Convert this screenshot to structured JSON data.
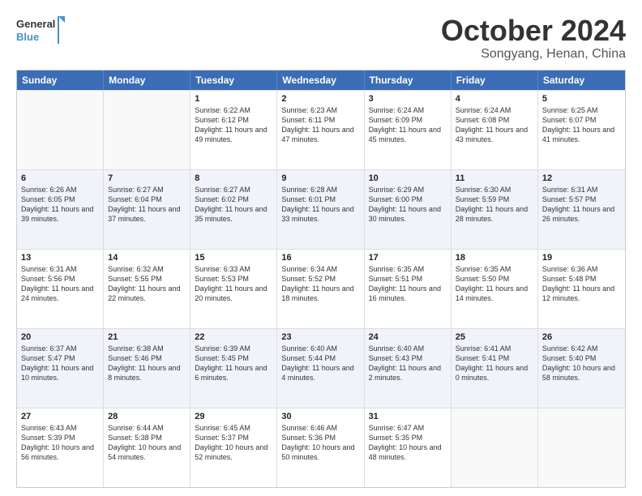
{
  "logo": {
    "line1": "General",
    "line2": "Blue"
  },
  "title": "October 2024",
  "subtitle": "Songyang, Henan, China",
  "header_days": [
    "Sunday",
    "Monday",
    "Tuesday",
    "Wednesday",
    "Thursday",
    "Friday",
    "Saturday"
  ],
  "weeks": [
    [
      {
        "day": "",
        "sunrise": "",
        "sunset": "",
        "daylight": ""
      },
      {
        "day": "",
        "sunrise": "",
        "sunset": "",
        "daylight": ""
      },
      {
        "day": "1",
        "sunrise": "Sunrise: 6:22 AM",
        "sunset": "Sunset: 6:12 PM",
        "daylight": "Daylight: 11 hours and 49 minutes."
      },
      {
        "day": "2",
        "sunrise": "Sunrise: 6:23 AM",
        "sunset": "Sunset: 6:11 PM",
        "daylight": "Daylight: 11 hours and 47 minutes."
      },
      {
        "day": "3",
        "sunrise": "Sunrise: 6:24 AM",
        "sunset": "Sunset: 6:09 PM",
        "daylight": "Daylight: 11 hours and 45 minutes."
      },
      {
        "day": "4",
        "sunrise": "Sunrise: 6:24 AM",
        "sunset": "Sunset: 6:08 PM",
        "daylight": "Daylight: 11 hours and 43 minutes."
      },
      {
        "day": "5",
        "sunrise": "Sunrise: 6:25 AM",
        "sunset": "Sunset: 6:07 PM",
        "daylight": "Daylight: 11 hours and 41 minutes."
      }
    ],
    [
      {
        "day": "6",
        "sunrise": "Sunrise: 6:26 AM",
        "sunset": "Sunset: 6:05 PM",
        "daylight": "Daylight: 11 hours and 39 minutes."
      },
      {
        "day": "7",
        "sunrise": "Sunrise: 6:27 AM",
        "sunset": "Sunset: 6:04 PM",
        "daylight": "Daylight: 11 hours and 37 minutes."
      },
      {
        "day": "8",
        "sunrise": "Sunrise: 6:27 AM",
        "sunset": "Sunset: 6:02 PM",
        "daylight": "Daylight: 11 hours and 35 minutes."
      },
      {
        "day": "9",
        "sunrise": "Sunrise: 6:28 AM",
        "sunset": "Sunset: 6:01 PM",
        "daylight": "Daylight: 11 hours and 33 minutes."
      },
      {
        "day": "10",
        "sunrise": "Sunrise: 6:29 AM",
        "sunset": "Sunset: 6:00 PM",
        "daylight": "Daylight: 11 hours and 30 minutes."
      },
      {
        "day": "11",
        "sunrise": "Sunrise: 6:30 AM",
        "sunset": "Sunset: 5:59 PM",
        "daylight": "Daylight: 11 hours and 28 minutes."
      },
      {
        "day": "12",
        "sunrise": "Sunrise: 6:31 AM",
        "sunset": "Sunset: 5:57 PM",
        "daylight": "Daylight: 11 hours and 26 minutes."
      }
    ],
    [
      {
        "day": "13",
        "sunrise": "Sunrise: 6:31 AM",
        "sunset": "Sunset: 5:56 PM",
        "daylight": "Daylight: 11 hours and 24 minutes."
      },
      {
        "day": "14",
        "sunrise": "Sunrise: 6:32 AM",
        "sunset": "Sunset: 5:55 PM",
        "daylight": "Daylight: 11 hours and 22 minutes."
      },
      {
        "day": "15",
        "sunrise": "Sunrise: 6:33 AM",
        "sunset": "Sunset: 5:53 PM",
        "daylight": "Daylight: 11 hours and 20 minutes."
      },
      {
        "day": "16",
        "sunrise": "Sunrise: 6:34 AM",
        "sunset": "Sunset: 5:52 PM",
        "daylight": "Daylight: 11 hours and 18 minutes."
      },
      {
        "day": "17",
        "sunrise": "Sunrise: 6:35 AM",
        "sunset": "Sunset: 5:51 PM",
        "daylight": "Daylight: 11 hours and 16 minutes."
      },
      {
        "day": "18",
        "sunrise": "Sunrise: 6:35 AM",
        "sunset": "Sunset: 5:50 PM",
        "daylight": "Daylight: 11 hours and 14 minutes."
      },
      {
        "day": "19",
        "sunrise": "Sunrise: 6:36 AM",
        "sunset": "Sunset: 5:48 PM",
        "daylight": "Daylight: 11 hours and 12 minutes."
      }
    ],
    [
      {
        "day": "20",
        "sunrise": "Sunrise: 6:37 AM",
        "sunset": "Sunset: 5:47 PM",
        "daylight": "Daylight: 11 hours and 10 minutes."
      },
      {
        "day": "21",
        "sunrise": "Sunrise: 6:38 AM",
        "sunset": "Sunset: 5:46 PM",
        "daylight": "Daylight: 11 hours and 8 minutes."
      },
      {
        "day": "22",
        "sunrise": "Sunrise: 6:39 AM",
        "sunset": "Sunset: 5:45 PM",
        "daylight": "Daylight: 11 hours and 6 minutes."
      },
      {
        "day": "23",
        "sunrise": "Sunrise: 6:40 AM",
        "sunset": "Sunset: 5:44 PM",
        "daylight": "Daylight: 11 hours and 4 minutes."
      },
      {
        "day": "24",
        "sunrise": "Sunrise: 6:40 AM",
        "sunset": "Sunset: 5:43 PM",
        "daylight": "Daylight: 11 hours and 2 minutes."
      },
      {
        "day": "25",
        "sunrise": "Sunrise: 6:41 AM",
        "sunset": "Sunset: 5:41 PM",
        "daylight": "Daylight: 11 hours and 0 minutes."
      },
      {
        "day": "26",
        "sunrise": "Sunrise: 6:42 AM",
        "sunset": "Sunset: 5:40 PM",
        "daylight": "Daylight: 10 hours and 58 minutes."
      }
    ],
    [
      {
        "day": "27",
        "sunrise": "Sunrise: 6:43 AM",
        "sunset": "Sunset: 5:39 PM",
        "daylight": "Daylight: 10 hours and 56 minutes."
      },
      {
        "day": "28",
        "sunrise": "Sunrise: 6:44 AM",
        "sunset": "Sunset: 5:38 PM",
        "daylight": "Daylight: 10 hours and 54 minutes."
      },
      {
        "day": "29",
        "sunrise": "Sunrise: 6:45 AM",
        "sunset": "Sunset: 5:37 PM",
        "daylight": "Daylight: 10 hours and 52 minutes."
      },
      {
        "day": "30",
        "sunrise": "Sunrise: 6:46 AM",
        "sunset": "Sunset: 5:36 PM",
        "daylight": "Daylight: 10 hours and 50 minutes."
      },
      {
        "day": "31",
        "sunrise": "Sunrise: 6:47 AM",
        "sunset": "Sunset: 5:35 PM",
        "daylight": "Daylight: 10 hours and 48 minutes."
      },
      {
        "day": "",
        "sunrise": "",
        "sunset": "",
        "daylight": ""
      },
      {
        "day": "",
        "sunrise": "",
        "sunset": "",
        "daylight": ""
      }
    ]
  ]
}
